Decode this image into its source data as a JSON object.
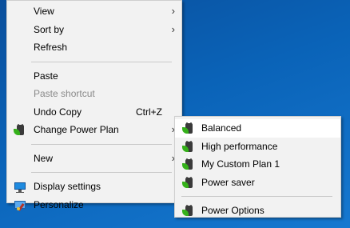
{
  "context_menu": {
    "items": [
      {
        "label": "View",
        "submenu": true
      },
      {
        "label": "Sort by",
        "submenu": true
      },
      {
        "label": "Refresh"
      },
      {
        "label": "Paste"
      },
      {
        "label": "Paste shortcut",
        "disabled": true
      },
      {
        "label": "Undo Copy",
        "shortcut": "Ctrl+Z"
      },
      {
        "label": "Change Power Plan",
        "submenu": true,
        "icon": "power-plan-icon"
      },
      {
        "label": "New",
        "submenu": true
      },
      {
        "label": "Display settings",
        "icon": "display-settings-icon"
      },
      {
        "label": "Personalize",
        "icon": "personalize-icon"
      }
    ]
  },
  "power_submenu": {
    "items": [
      {
        "label": "Balanced",
        "icon": "power-plan-icon",
        "highlighted": true
      },
      {
        "label": "High performance",
        "icon": "power-plan-icon"
      },
      {
        "label": "My Custom Plan 1",
        "icon": "power-plan-icon"
      },
      {
        "label": "Power saver",
        "icon": "power-plan-icon"
      },
      {
        "label": "Power Options",
        "icon": "power-plan-icon"
      }
    ]
  },
  "glyphs": {
    "submenu_arrow": "›"
  },
  "colors": {
    "menu_bg": "#f2f2f2",
    "highlight": "#ffffff",
    "desktop": "#0a63b8",
    "disabled_text": "#8a8a8a"
  }
}
